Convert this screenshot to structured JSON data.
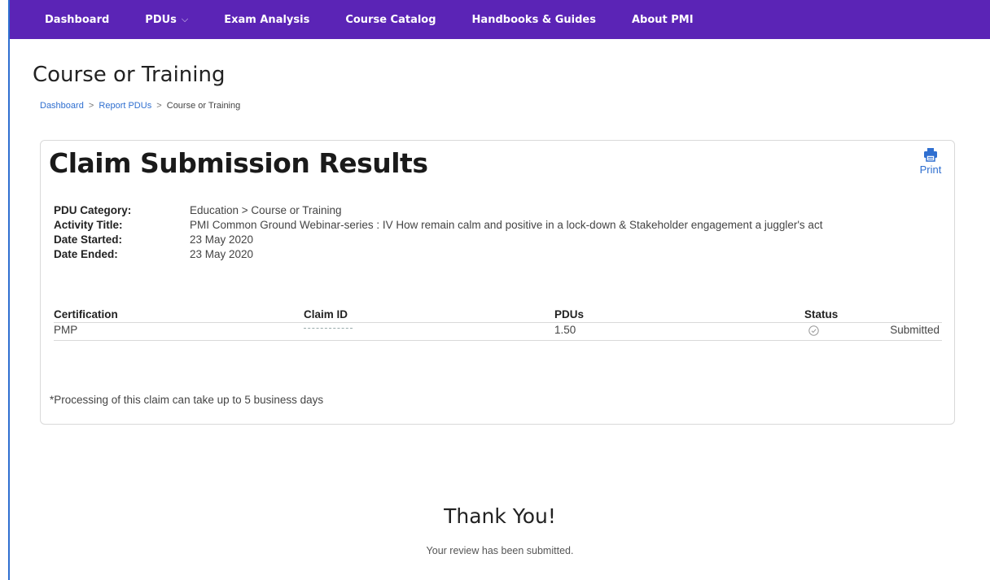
{
  "nav": {
    "items": [
      {
        "label": "Dashboard"
      },
      {
        "label": "PDUs"
      },
      {
        "label": "Exam Analysis"
      },
      {
        "label": "Course Catalog"
      },
      {
        "label": "Handbooks & Guides"
      },
      {
        "label": "About PMI"
      }
    ],
    "pdus_chevron": "⌵"
  },
  "page": {
    "title": "Course or Training"
  },
  "breadcrumb": {
    "items": [
      "Dashboard",
      "Report PDUs",
      "Course or Training"
    ],
    "separator": ">"
  },
  "card": {
    "title": "Claim Submission Results",
    "print_label": "Print",
    "print_icon": "printer-icon",
    "details": [
      {
        "key": "PDU Category:",
        "value": "Education > Course or Training"
      },
      {
        "key": "Activity Title:",
        "value": "PMI Common Ground Webinar-series : IV How remain calm and positive in a lock-down & Stakeholder engagement a juggler's act"
      },
      {
        "key": "Date Started:",
        "value": "23 May 2020"
      },
      {
        "key": "Date Ended:",
        "value": "23 May 2020"
      }
    ],
    "table": {
      "headers": [
        "Certification",
        "Claim ID",
        "PDUs",
        "Status"
      ],
      "rows": [
        {
          "certification": "PMP",
          "claim_id": "",
          "pdus": "1.50",
          "status_icon": "check-circle-icon",
          "status": "Submitted"
        }
      ]
    },
    "note": "*Processing of this claim can take up to 5 business days"
  },
  "thanks": {
    "title": "Thank You!",
    "subtitle": "Your review has been submitted."
  },
  "colors": {
    "nav_bg": "#5b24b6",
    "link": "#2f6fd0",
    "border": "#d9d9d9"
  }
}
